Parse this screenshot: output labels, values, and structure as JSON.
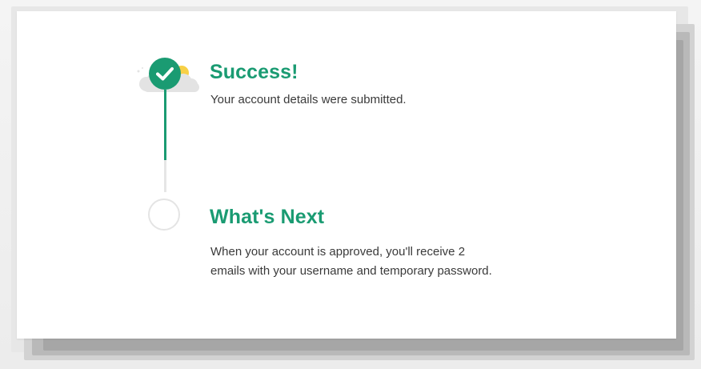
{
  "steps": [
    {
      "status": "complete",
      "title": "Success!",
      "description": "Your account details were submitted.",
      "icon": "check-circle-icon"
    },
    {
      "status": "pending",
      "title": "What's Next",
      "description_lines": [
        "When your account is approved, you'll receive 2",
        "emails with your username and temporary password."
      ],
      "icon": "empty-circle-icon"
    }
  ],
  "colors": {
    "accent": "#1a9b72",
    "text": "#3a3a3a",
    "pending_line": "#e6e6e6",
    "sun": "#f7d046",
    "cloud": "#e3e3e3"
  }
}
